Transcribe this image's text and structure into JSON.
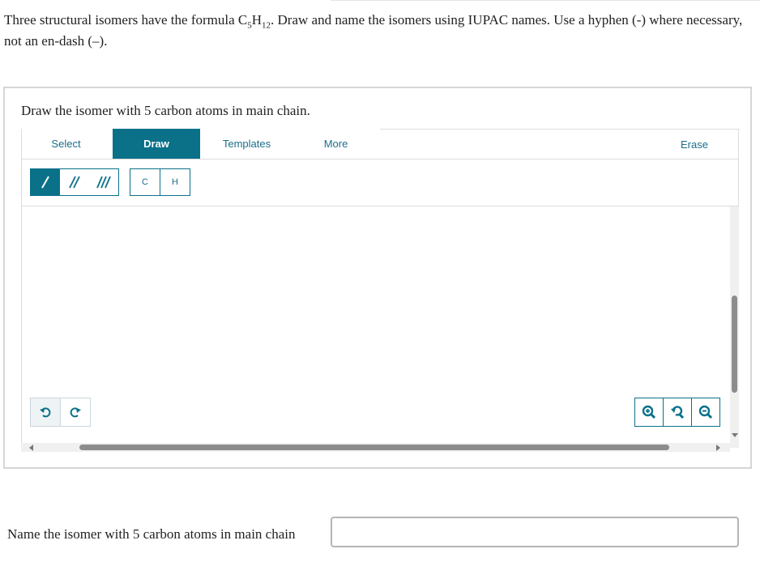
{
  "question": {
    "line1_prefix": "Three structural isomers have the formula C",
    "sub1": "5",
    "mid": "H",
    "sub2": "12",
    "line1_suffix": ". Draw and name the isomers using IUPAC names. Use a hyphen (-) where necessary, not an en-dash (–)."
  },
  "panel": {
    "title": "Draw the isomer with 5 carbon atoms in main chain."
  },
  "toolbar": {
    "tabs": [
      "Select",
      "Draw",
      "Templates",
      "More"
    ],
    "active_tab": "Draw",
    "erase_label": "Erase"
  },
  "draw_tools": {
    "bond_icons": [
      "single-bond-icon",
      "double-bond-icon",
      "triple-bond-icon"
    ],
    "atoms": [
      "C",
      "H"
    ]
  },
  "canvas_controls": {
    "undo_icon": "undo-icon",
    "redo_icon": "redo-icon",
    "zoom_icons": [
      "zoom-in-icon",
      "reset-zoom-icon",
      "zoom-out-icon"
    ]
  },
  "answer": {
    "label": "Name the isomer with 5 carbon atoms in main chain",
    "value": ""
  },
  "colors": {
    "accent": "#0a7189",
    "border": "#d6d6d6"
  }
}
